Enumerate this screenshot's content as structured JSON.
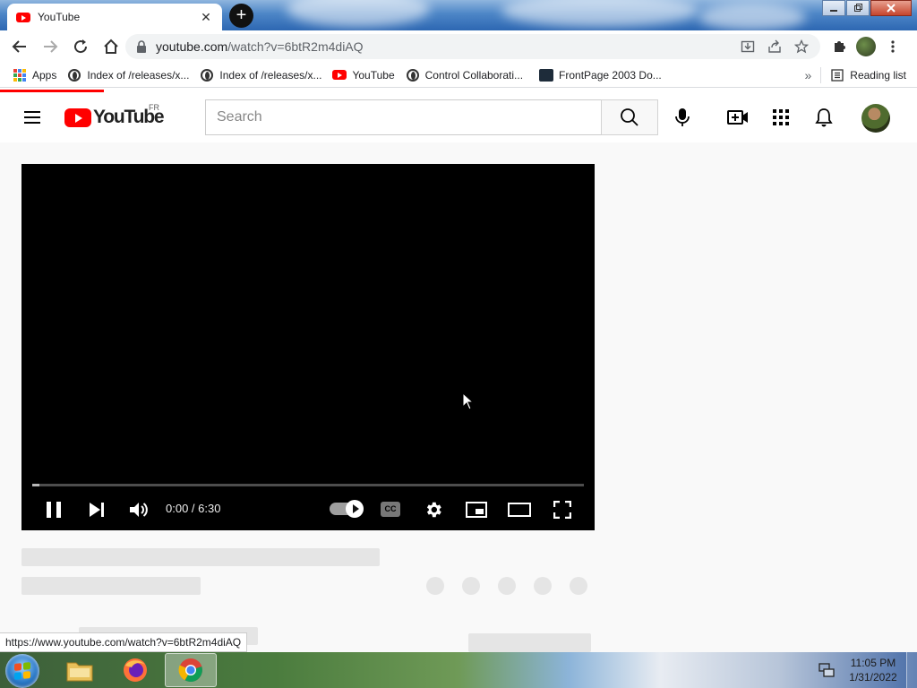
{
  "browser": {
    "tab_title": "YouTube",
    "tab_close": "✕",
    "new_tab": "+",
    "url_host": "youtube.com",
    "url_path": "/watch?v=6btR2m4diAQ",
    "status_url": "https://www.youtube.com/watch?v=6btR2m4diAQ",
    "bookmarks": [
      {
        "label": "Apps",
        "icon": "apps-grid-icon"
      },
      {
        "label": "Index of /releases/x...",
        "icon": "globe-icon"
      },
      {
        "label": "Index of /releases/x...",
        "icon": "globe-icon"
      },
      {
        "label": "YouTube",
        "icon": "youtube-icon"
      },
      {
        "label": "Control Collaborati...",
        "icon": "globe-icon"
      },
      {
        "label": "FrontPage 2003 Do...",
        "icon": "frontpage-icon"
      }
    ],
    "bookmarks_overflow": "»",
    "reading_list": "Reading list"
  },
  "youtube": {
    "logo_text": "YouTube",
    "region": "FR",
    "search_placeholder": "Search"
  },
  "player": {
    "time": "0:00 / 6:30",
    "cc_label": "CC",
    "progress_fraction": 0.0
  },
  "taskbar": {
    "time": "11:05 PM",
    "date": "1/31/2022"
  },
  "colors": {
    "youtube_red": "#ff0000",
    "player_bg": "#000000",
    "skeleton": "#e5e5e5"
  }
}
